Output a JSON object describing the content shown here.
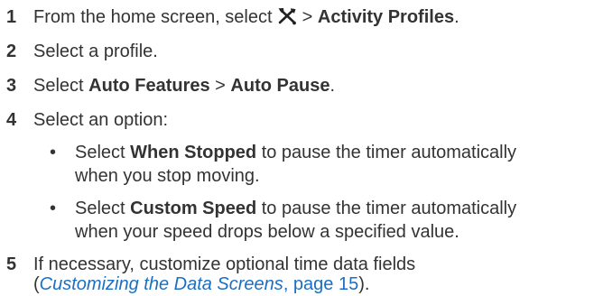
{
  "steps": [
    {
      "number": "1",
      "pre": "From the home screen, select ",
      "icon": "settings-wrench-icon",
      "mid": " > ",
      "bold": "Activity Profiles",
      "post": "."
    },
    {
      "number": "2",
      "text": "Select a profile."
    },
    {
      "number": "3",
      "pre": "Select ",
      "bold1": "Auto Features",
      "mid": " > ",
      "bold2": "Auto Pause",
      "post": "."
    },
    {
      "number": "4",
      "text": "Select an option:"
    },
    {
      "number": "5",
      "line1": "If necessary, customize optional time data fields",
      "open_paren": "(",
      "link_text": "Customizing the Data Screens",
      "link_suffix": ", page ",
      "page_number": "15",
      "close": ")."
    }
  ],
  "options": [
    {
      "bullet": "•",
      "pre": "Select ",
      "bold": "When Stopped",
      "line1_post": " to pause the timer automatically",
      "line2": "when you stop moving."
    },
    {
      "bullet": "•",
      "pre": "Select ",
      "bold": "Custom Speed",
      "line1_post": " to pause the timer automatically",
      "line2": "when your speed drops below a specified value."
    }
  ]
}
